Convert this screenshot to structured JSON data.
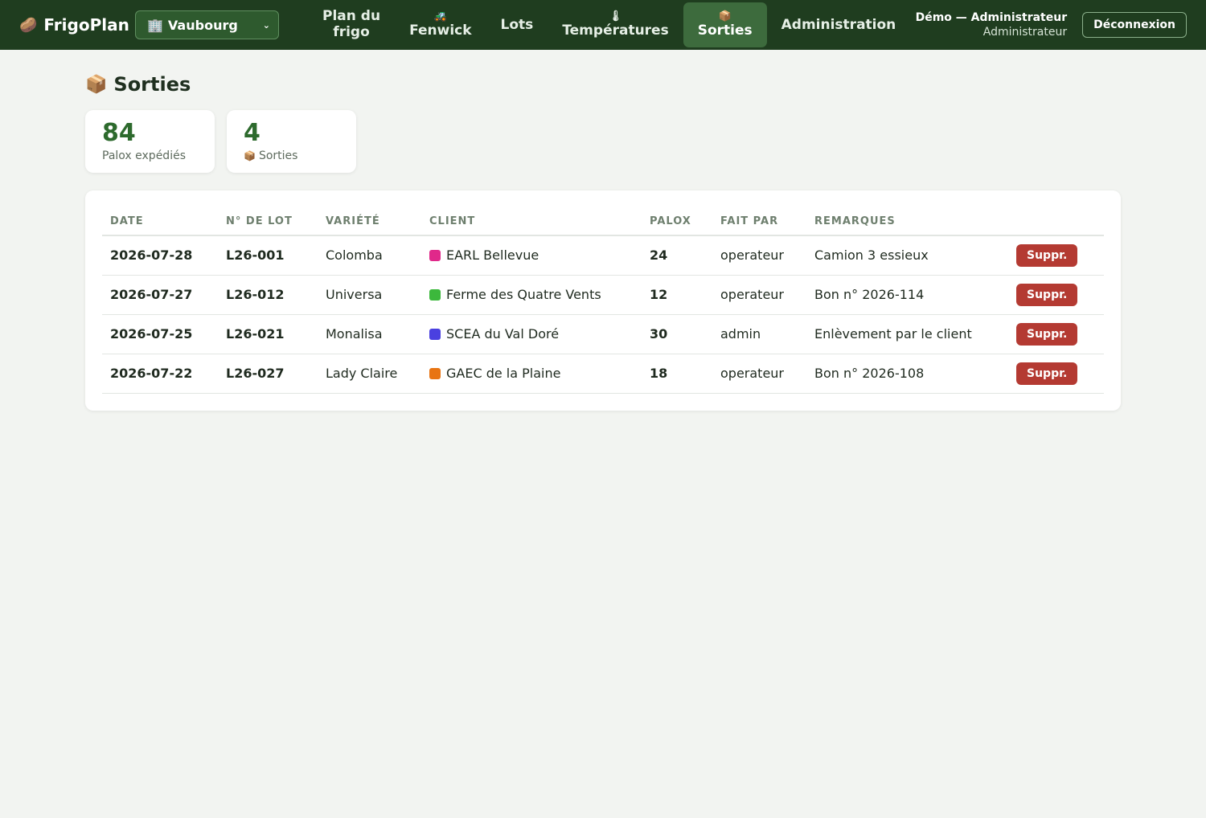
{
  "nav": {
    "brand_icon": "🥔",
    "brand": "FrigoPlan",
    "site_icon": "🏢",
    "site": "Vaubourg",
    "items": [
      {
        "icon": "",
        "label_line1": "Plan du",
        "label_line2": "frigo"
      },
      {
        "icon": "🚜",
        "label": "Fenwick"
      },
      {
        "icon": "",
        "label": "Lots"
      },
      {
        "icon": "🌡",
        "label": "Températures"
      },
      {
        "icon": "📦",
        "label": "Sorties"
      },
      {
        "icon": "",
        "label": "Administration"
      }
    ],
    "active": "Sorties",
    "user_name": "Démo — Administrateur",
    "user_role": "Administrateur",
    "logout": "Déconnexion"
  },
  "page": {
    "icon": "📦",
    "title": "Sorties"
  },
  "stats": [
    {
      "value": "84",
      "label": "Palox expédiés"
    },
    {
      "value": "4",
      "icon": "📦",
      "label": "Sorties"
    }
  ],
  "table": {
    "headers": [
      "DATE",
      "N° DE LOT",
      "VARIÉTÉ",
      "CLIENT",
      "PALOX",
      "FAIT PAR",
      "REMARQUES"
    ],
    "rows": [
      {
        "date": "2026-07-28",
        "lot": "L26-001",
        "variety": "Colomba",
        "client": "EARL Bellevue",
        "client_color": "#e0288a",
        "palox": "24",
        "by": "operateur",
        "remarks": "Camion 3 essieux",
        "action": "Suppr."
      },
      {
        "date": "2026-07-27",
        "lot": "L26-012",
        "variety": "Universa",
        "client": "Ferme des Quatre Vents",
        "client_color": "#3cb83c",
        "palox": "12",
        "by": "operateur",
        "remarks": "Bon n° 2026-114",
        "action": "Suppr."
      },
      {
        "date": "2026-07-25",
        "lot": "L26-021",
        "variety": "Monalisa",
        "client": "SCEA du Val Doré",
        "client_color": "#4a40e0",
        "palox": "30",
        "by": "admin",
        "remarks": "Enlèvement par le client",
        "action": "Suppr."
      },
      {
        "date": "2026-07-22",
        "lot": "L26-027",
        "variety": "Lady Claire",
        "client": "GAEC de la Plaine",
        "client_color": "#e87412",
        "palox": "18",
        "by": "operateur",
        "remarks": "Bon n° 2026-108",
        "action": "Suppr."
      }
    ]
  },
  "colors": {
    "nav_bg": "#1f3d1f",
    "accent": "#2d6a2d",
    "danger": "#b43a32"
  }
}
